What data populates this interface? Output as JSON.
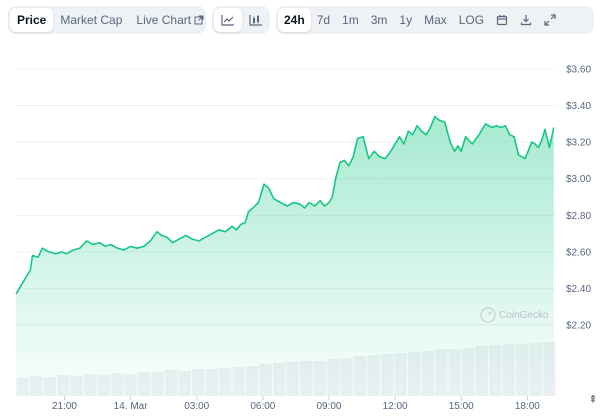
{
  "toolbar": {
    "tabs": [
      {
        "label": "Price",
        "active": true
      },
      {
        "label": "Market Cap",
        "active": false
      },
      {
        "label": "Live Chart",
        "active": false
      }
    ],
    "ranges": [
      {
        "label": "24h",
        "active": true
      },
      {
        "label": "7d",
        "active": false
      },
      {
        "label": "1m",
        "active": false
      },
      {
        "label": "3m",
        "active": false
      },
      {
        "label": "1y",
        "active": false
      },
      {
        "label": "Max",
        "active": false
      },
      {
        "label": "LOG",
        "active": false
      }
    ],
    "icons": {
      "line": "line-chart-icon",
      "candle": "candlestick-icon",
      "calendar": "calendar-icon",
      "download": "download-icon",
      "fullscreen": "fullscreen-icon",
      "external": "external-link-icon"
    }
  },
  "watermark": "CoinGecko",
  "colors": {
    "line": "#16c784",
    "accent_bg": "#eff2f5",
    "text_muted": "#58667e"
  },
  "chart_data": {
    "type": "line",
    "ylim": [
      2.1,
      3.65
    ],
    "y_ticks": [
      "$3.60",
      "$3.40",
      "$3.20",
      "$3.00",
      "$2.80",
      "$2.60",
      "$2.40",
      "$2.20"
    ],
    "y_tick_values": [
      3.6,
      3.4,
      3.2,
      3.0,
      2.8,
      2.6,
      2.4,
      2.2
    ],
    "x_ticks": [
      "21:00",
      "14. Mar",
      "03:00",
      "06:00",
      "09:00",
      "12:00",
      "15:00",
      "18:00"
    ],
    "x_tick_hours": [
      2,
      5,
      8,
      11,
      14,
      17,
      20,
      23
    ],
    "x_range_hours": [
      -0.2,
      24.3
    ],
    "price": {
      "hours": [
        -0.2,
        0.2,
        0.45,
        0.55,
        0.8,
        1.0,
        1.3,
        1.6,
        1.85,
        2.1,
        2.4,
        2.7,
        3.0,
        3.3,
        3.6,
        3.85,
        4.1,
        4.4,
        4.7,
        5.0,
        5.3,
        5.6,
        5.9,
        6.2,
        6.4,
        6.65,
        6.9,
        7.2,
        7.5,
        7.8,
        8.1,
        8.4,
        8.7,
        9.0,
        9.3,
        9.6,
        9.8,
        10.0,
        10.2,
        10.35,
        10.55,
        10.8,
        10.95,
        11.05,
        11.25,
        11.5,
        11.8,
        12.1,
        12.4,
        12.7,
        12.9,
        13.1,
        13.35,
        13.6,
        13.8,
        14.0,
        14.15,
        14.3,
        14.5,
        14.7,
        14.9,
        15.1,
        15.3,
        15.55,
        15.8,
        16.05,
        16.3,
        16.55,
        16.8,
        17.0,
        17.2,
        17.4,
        17.6,
        17.8,
        18.0,
        18.2,
        18.4,
        18.6,
        18.8,
        19.0,
        19.25,
        19.5,
        19.7,
        19.85,
        20.0,
        20.2,
        20.5,
        20.8,
        21.1,
        21.4,
        21.6,
        21.8,
        22.0,
        22.2,
        22.4,
        22.6,
        22.9,
        23.2,
        23.35,
        23.5,
        23.65,
        23.8,
        24.0,
        24.2
      ],
      "values": [
        2.37,
        2.45,
        2.5,
        2.58,
        2.57,
        2.62,
        2.6,
        2.59,
        2.6,
        2.59,
        2.61,
        2.62,
        2.66,
        2.64,
        2.65,
        2.63,
        2.64,
        2.62,
        2.61,
        2.63,
        2.62,
        2.63,
        2.66,
        2.71,
        2.69,
        2.68,
        2.65,
        2.67,
        2.69,
        2.67,
        2.66,
        2.68,
        2.7,
        2.72,
        2.71,
        2.74,
        2.72,
        2.75,
        2.76,
        2.82,
        2.84,
        2.87,
        2.93,
        2.97,
        2.95,
        2.89,
        2.87,
        2.85,
        2.87,
        2.86,
        2.84,
        2.87,
        2.85,
        2.88,
        2.85,
        2.87,
        2.9,
        3.0,
        3.09,
        3.1,
        3.07,
        3.12,
        3.22,
        3.23,
        3.11,
        3.15,
        3.12,
        3.11,
        3.15,
        3.19,
        3.23,
        3.19,
        3.26,
        3.24,
        3.29,
        3.26,
        3.24,
        3.28,
        3.34,
        3.32,
        3.31,
        3.2,
        3.15,
        3.18,
        3.15,
        3.23,
        3.19,
        3.24,
        3.3,
        3.28,
        3.29,
        3.28,
        3.29,
        3.24,
        3.23,
        3.13,
        3.11,
        3.2,
        3.19,
        3.17,
        3.21,
        3.27,
        3.17,
        3.28
      ]
    },
    "volume": {
      "values": [
        18,
        20,
        19,
        21,
        20,
        22,
        21,
        23,
        22,
        24,
        24,
        26,
        25,
        27,
        27,
        28,
        29,
        30,
        32,
        33,
        34,
        35,
        35,
        37,
        38,
        40,
        41,
        42,
        43,
        44,
        45,
        47,
        47,
        48,
        50,
        51,
        52,
        52,
        53,
        54
      ]
    },
    "grid": "horizontal",
    "legend": "none"
  }
}
